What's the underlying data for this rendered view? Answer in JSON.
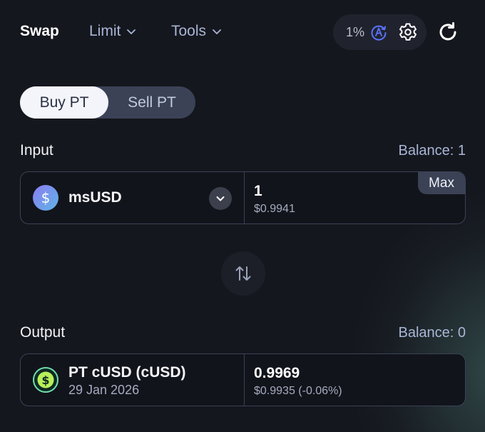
{
  "nav": {
    "swap_label": "Swap",
    "limit_label": "Limit",
    "tools_label": "Tools"
  },
  "settings": {
    "slippage": "1%",
    "auto_icon": "auto-slippage-icon",
    "gear_icon": "gear-icon",
    "refresh_icon": "refresh-icon"
  },
  "toggle": {
    "buy_label": "Buy PT",
    "sell_label": "Sell PT",
    "selected": "Buy PT"
  },
  "input": {
    "label": "Input",
    "balance": "Balance: 1",
    "token_name": "msUSD",
    "token_icon": "dollar-coin-icon",
    "amount": "1",
    "usd_value": "$0.9941",
    "max_label": "Max"
  },
  "output": {
    "label": "Output",
    "balance": "Balance: 0",
    "token_name": "PT cUSD (cUSD)",
    "token_date": "29 Jan 2026",
    "token_icon": "dollar-coin-icon",
    "amount": "0.9969",
    "usd_value": "$0.9935 (-0.06%)"
  },
  "colors": {
    "background": "#15171e",
    "accent_blue": "#5b73ff",
    "toggle_active": "#f3f5fa",
    "border": "#3b4256",
    "muted_text": "#a9b6d6"
  }
}
